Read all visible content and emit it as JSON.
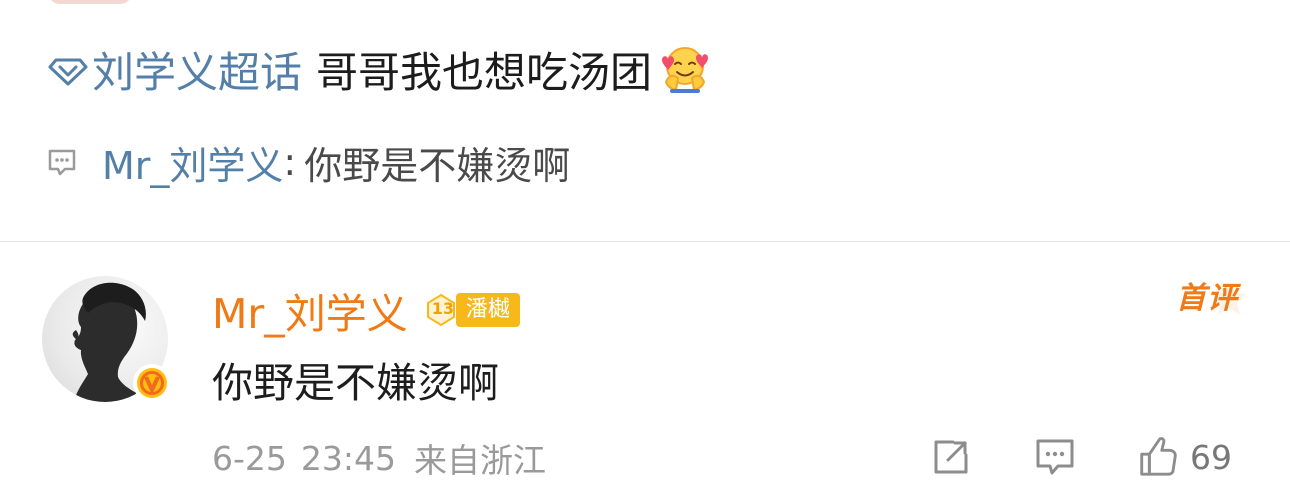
{
  "post": {
    "topic": "刘学义超话",
    "text": "哥哥我也想吃汤团"
  },
  "comment_summary": {
    "username": "Mr_刘学义",
    "separator": ":",
    "text": "你野是不嫌烫啊"
  },
  "comment": {
    "username": "Mr_刘学义",
    "fan_level": "13",
    "fan_name": "潘樾",
    "tag": "首评",
    "text": "你野是不嫌烫啊",
    "date": "6-25",
    "time": "23:45",
    "location": "来自浙江",
    "like_count": "69"
  },
  "icons": {
    "topic": "diamond-topic-icon",
    "emoji": "hug-face-icon",
    "comment_summary": "comment-bubble-icon",
    "verified": "verified-v-icon",
    "share": "share-icon",
    "comment": "comment-icon",
    "like": "thumbs-up-icon"
  },
  "colors": {
    "link_blue": "#537fa8",
    "accent_orange": "#f07a16",
    "fan_badge_yellow": "#f7b81b",
    "meta_gray": "#9a9a9a"
  }
}
